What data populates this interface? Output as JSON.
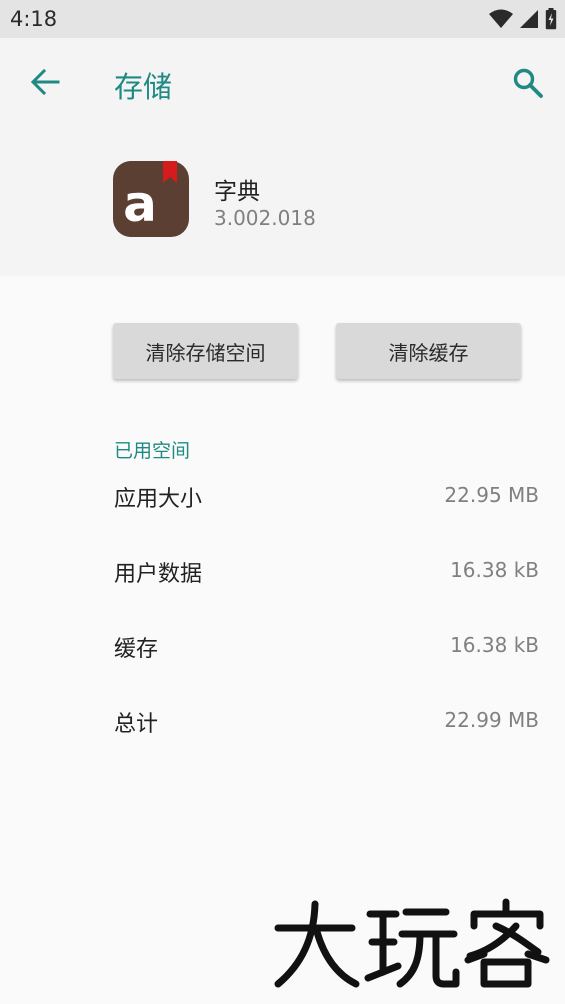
{
  "status_bar": {
    "time": "4:18",
    "icons": [
      "wifi-icon",
      "signal-icon",
      "battery-icon"
    ]
  },
  "toolbar": {
    "title": "存储",
    "back_icon": "arrow-back-icon",
    "search_icon": "search-icon",
    "accent_color": "#1f8a84"
  },
  "app": {
    "name": "字典",
    "version": "3.002.018",
    "icon": "dictionary-app-icon",
    "icon_color": "#5b3f33",
    "bookmark_color": "#d51b1b"
  },
  "buttons": {
    "clear_storage": "清除存储空间",
    "clear_cache": "清除缓存"
  },
  "storage": {
    "section_title": "已用空间",
    "rows": [
      {
        "label": "应用大小",
        "value": "22.95 MB"
      },
      {
        "label": "用户数据",
        "value": "16.38 kB"
      },
      {
        "label": "缓存",
        "value": "16.38 kB"
      },
      {
        "label": "总计",
        "value": "22.99 MB"
      }
    ]
  },
  "watermark": {
    "text": "大玩客"
  }
}
